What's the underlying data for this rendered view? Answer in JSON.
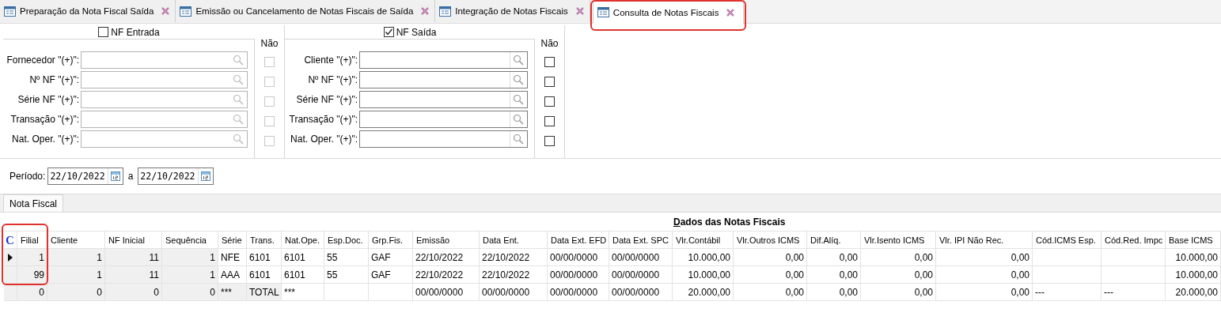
{
  "tabs": [
    {
      "label": "Preparação da Nota Fiscal Saída",
      "selected": false,
      "highlighted": false
    },
    {
      "label": "Emissão ou Cancelamento de Notas Fiscais de Saída",
      "selected": false,
      "highlighted": false
    },
    {
      "label": "Integração de Notas Fiscais",
      "selected": false,
      "highlighted": false
    },
    {
      "label": "Consulta de Notas Fiscais",
      "selected": true,
      "highlighted": true
    }
  ],
  "filter_groups": [
    {
      "label": "NF Entrada",
      "checked": false,
      "negate_label": "Não",
      "fields": [
        {
          "label": "Fornecedor \"(+)\":",
          "negate": false
        },
        {
          "label": "Nº NF \"(+)\":",
          "negate": false
        },
        {
          "label": "Série NF \"(+)\":",
          "negate": false
        },
        {
          "label": "Transação \"(+)\":",
          "negate": false
        },
        {
          "label": "Nat. Oper. \"(+)\":",
          "negate": false
        }
      ]
    },
    {
      "label": "NF Saída",
      "checked": true,
      "negate_label": "Não",
      "fields": [
        {
          "label": "Cliente \"(+)\":",
          "negate": false
        },
        {
          "label": "Nº NF \"(+)\":",
          "negate": false
        },
        {
          "label": "Série NF \"(+)\":",
          "negate": false
        },
        {
          "label": "Transação \"(+)\":",
          "negate": false
        },
        {
          "label": "Nat. Oper. \"(+)\":",
          "negate": false
        }
      ]
    }
  ],
  "period": {
    "label": "Período:",
    "from": "22/10/2022",
    "separator": "a",
    "to": "22/10/2022"
  },
  "grid_tabs": [
    {
      "label": "Nota Fiscal",
      "selected": true
    }
  ],
  "grid": {
    "title": "Dados das Notas Fiscais",
    "corner": "C",
    "columns": [
      {
        "label": "Filial",
        "kind": "frozen",
        "highlighted": true
      },
      {
        "label": "Cliente",
        "kind": "frozen",
        "highlighted": false
      },
      {
        "label": "NF Inicial",
        "kind": "frozen",
        "highlighted": false
      },
      {
        "label": "Sequência",
        "kind": "frozen",
        "highlighted": false
      },
      {
        "label": "Série",
        "kind": "key",
        "highlighted": false
      },
      {
        "label": "Trans.",
        "kind": "key",
        "highlighted": false
      },
      {
        "label": "Nat.Ope.",
        "kind": "plain",
        "highlighted": false
      },
      {
        "label": "Esp.Doc.",
        "kind": "plain",
        "highlighted": false
      },
      {
        "label": "Grp.Fis.",
        "kind": "plain",
        "highlighted": false
      },
      {
        "label": "Emissão",
        "kind": "plain",
        "highlighted": false
      },
      {
        "label": "Data Ent.",
        "kind": "plain",
        "highlighted": false
      },
      {
        "label": "Data Ext. EFD",
        "kind": "plain",
        "highlighted": false
      },
      {
        "label": "Data Ext. SPC",
        "kind": "plain",
        "highlighted": false
      },
      {
        "label": "Vlr.Contábil",
        "kind": "plain",
        "highlighted": false
      },
      {
        "label": "Vlr.Outros ICMS",
        "kind": "plain",
        "highlighted": false
      },
      {
        "label": "Dif.Alíq.",
        "kind": "plain",
        "highlighted": false
      },
      {
        "label": "Vlr.Isento ICMS",
        "kind": "plain",
        "highlighted": false
      },
      {
        "label": "Vlr. IPI Não Rec.",
        "kind": "plain",
        "highlighted": false
      },
      {
        "label": "Cód.ICMS Esp.",
        "kind": "plain",
        "highlighted": false
      },
      {
        "label": "Cód.Red. Impc",
        "kind": "plain",
        "highlighted": false
      },
      {
        "label": "Base ICMS",
        "kind": "plain",
        "highlighted": false
      }
    ],
    "rows": [
      {
        "kind": "data",
        "selected": true,
        "cells": [
          "1",
          "1",
          "11",
          "1",
          "NFE",
          "6101",
          "6101",
          "55",
          "GAF",
          "22/10/2022",
          "22/10/2022",
          "00/00/0000",
          "00/00/0000",
          "10.000,00",
          "0,00",
          "0,00",
          "0,00",
          "0,00",
          null,
          null,
          "10.000,00"
        ]
      },
      {
        "kind": "data",
        "selected": false,
        "cells": [
          "99",
          "1",
          "11",
          "1",
          "AAA",
          "6101",
          "6101",
          "55",
          "GAF",
          "22/10/2022",
          "22/10/2022",
          "00/00/0000",
          "00/00/0000",
          "10.000,00",
          "0,00",
          "0,00",
          "0,00",
          "0,00",
          null,
          null,
          "10.000,00"
        ]
      },
      {
        "kind": "total",
        "selected": false,
        "cells": [
          "0",
          "0",
          "0",
          "0",
          "***",
          "TOTAL",
          "***",
          null,
          null,
          "00/00/0000",
          "00/00/0000",
          "00/00/0000",
          "00/00/0000",
          "20.000,00",
          "0,00",
          "0,00",
          "0,00",
          "0,00",
          "---",
          "---",
          "20.000,00"
        ]
      }
    ]
  }
}
